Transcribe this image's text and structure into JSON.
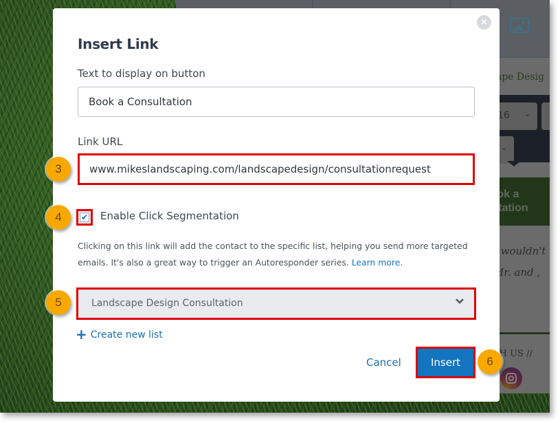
{
  "background_editor": {
    "headline_fragment": "cape Desig",
    "font_size_value": "16",
    "button_preview_text_line1": "Book a",
    "button_preview_text_line2": "sultation",
    "testimonial_line1": "I wouldn't",
    "testimonial_line2": "Mr. and ,",
    "follow_text": "TH US //",
    "icons": {
      "image": "image-icon",
      "instagram": "instagram-icon"
    }
  },
  "modal": {
    "title": "Insert Link",
    "close_icon": "×",
    "display_text_label": "Text to display on button",
    "display_text_value": "Book a Consultation",
    "link_url_label": "Link URL",
    "link_url_value": "www.mikeslandscaping.com/landscapedesign/consultationrequest",
    "click_segmentation": {
      "checked": true,
      "check_glyph": "✔",
      "label": "Enable Click Segmentation"
    },
    "help_text": "Clicking on this link will add the contact to the specific list, helping you send more targeted emails. It's also a great way to trigger an Autoresponder series.",
    "learn_more_label": "Learn more.",
    "list_select": {
      "selected": "Landscape Design Consultation"
    },
    "create_list_icon": "+",
    "create_list_label": "Create new list",
    "cancel_label": "Cancel",
    "insert_label": "Insert"
  },
  "callouts": [
    "3",
    "4",
    "5",
    "6"
  ],
  "colors": {
    "highlight_red": "#e00000",
    "callout_orange": "#f9a800",
    "primary_blue": "#1374c0",
    "link_blue": "#1a6fb5",
    "title_text": "#2f3b4a"
  }
}
